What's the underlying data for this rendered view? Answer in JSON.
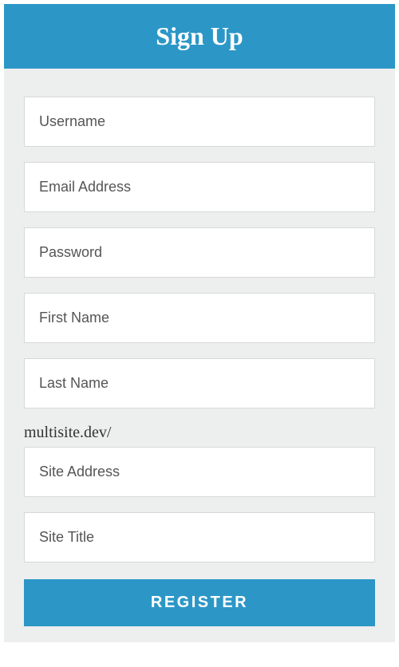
{
  "header": {
    "title": "Sign Up"
  },
  "form": {
    "username": {
      "placeholder": "Username",
      "value": ""
    },
    "email": {
      "placeholder": "Email Address",
      "value": ""
    },
    "password": {
      "placeholder": "Password",
      "value": ""
    },
    "first_name": {
      "placeholder": "First Name",
      "value": ""
    },
    "last_name": {
      "placeholder": "Last Name",
      "value": ""
    },
    "site_prefix": "multisite.dev/",
    "site_address": {
      "placeholder": "Site Address",
      "value": ""
    },
    "site_title": {
      "placeholder": "Site Title",
      "value": ""
    },
    "submit_label": "REGISTER"
  }
}
